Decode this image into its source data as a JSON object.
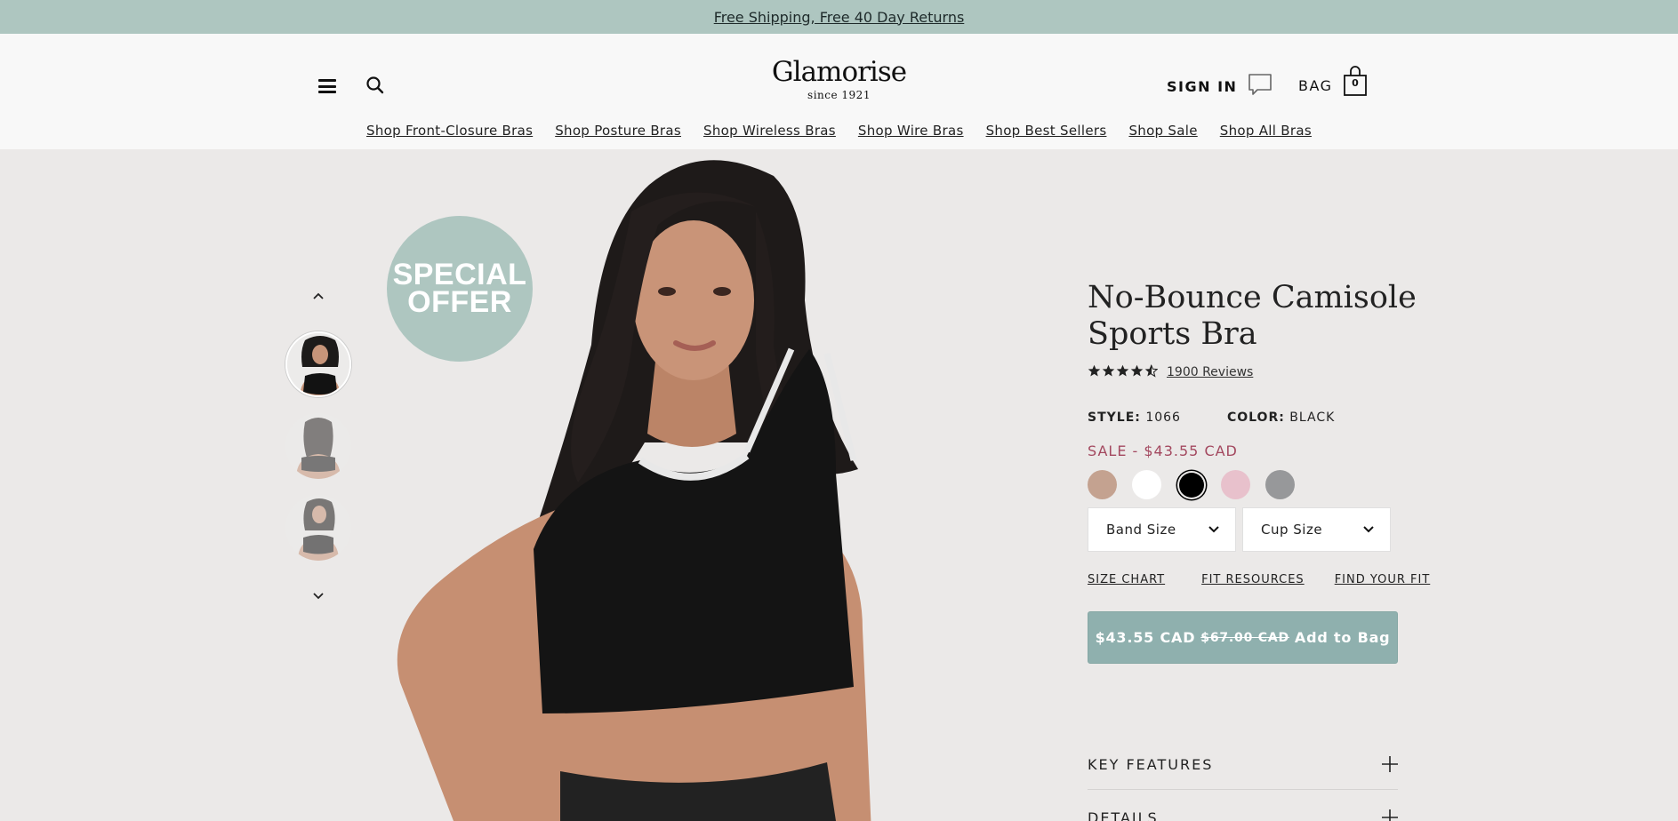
{
  "promo": {
    "text": "Free Shipping, Free 40 Day Returns"
  },
  "header": {
    "brand": "Glamorise",
    "since": "since 1921",
    "sign_in": "SIGN IN",
    "bag_label": "BAG",
    "bag_count": "0"
  },
  "nav": [
    "Shop Front-Closure Bras",
    "Shop Posture Bras",
    "Shop Wireless Bras",
    "Shop Wire Bras",
    "Shop Best Sellers",
    "Shop Sale",
    "Shop All Bras"
  ],
  "gallery": {
    "offer_line1": "SPECIAL",
    "offer_line2": "OFFER"
  },
  "product": {
    "title": "No-Bounce Camisole Sports Bra",
    "rating": 4.5,
    "reviews": "1900 Reviews",
    "style_label": "STYLE:",
    "style_value": "1066",
    "color_label": "COLOR:",
    "color_value": "BLACK",
    "sale_price": "SALE - $43.55 CAD",
    "swatches": [
      {
        "name": "nude",
        "color": "#c4a290"
      },
      {
        "name": "white",
        "color": "#ffffff"
      },
      {
        "name": "black",
        "color": "#000000",
        "selected": true
      },
      {
        "name": "pink",
        "color": "#e8c1cc"
      },
      {
        "name": "gray",
        "color": "#97989a"
      }
    ],
    "band_size": "Band Size",
    "cup_size": "Cup Size",
    "size_chart": "SIZE CHART",
    "fit_resources": "FIT RESOURCES",
    "find_your_fit": "FIND YOUR FIT",
    "add_price": "$43.55 CAD",
    "add_orig_price": "$67.00 CAD",
    "add_label": "Add to Bag",
    "key_features": "KEY FEATURES",
    "details": "DETAILS"
  },
  "colors": {
    "accent": "#aec6c0",
    "button": "#8fb0ae",
    "sale": "#a3485f"
  }
}
